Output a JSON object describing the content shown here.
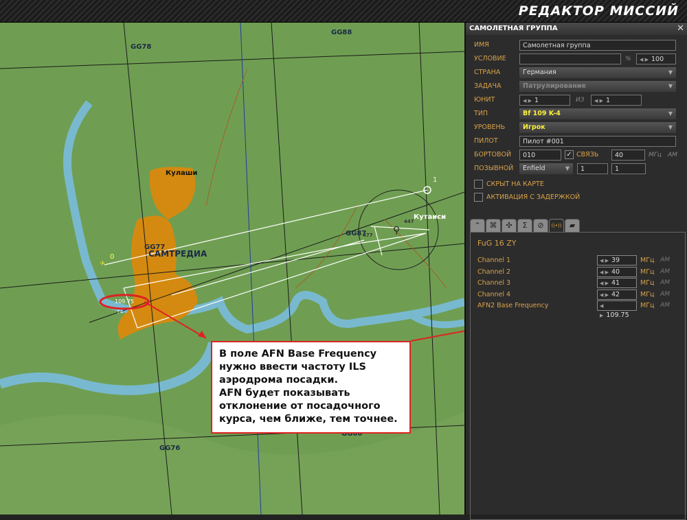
{
  "app_title": "РЕДАКТОР МИССИЙ",
  "map": {
    "grid_labels": [
      "GG88",
      "GG78",
      "GG77",
      "GG87",
      "GG76",
      "GG66"
    ],
    "cities": [
      "Кулаши",
      "САМТРЕДИА",
      "Кутаиси"
    ],
    "waypoints": [
      "0",
      "1"
    ],
    "airfield_freq": "109.75",
    "small_labels": [
      "477",
      "447",
      "74"
    ]
  },
  "panel": {
    "title": "САМОЛЕТНАЯ ГРУППА",
    "close_icon": "close-icon",
    "fields": {
      "name_label": "ИМЯ",
      "name_value": "Самолетная группа",
      "condition_label": "УСЛОВИЕ",
      "condition_value": "",
      "percent_sign": "%",
      "percent_value": "100",
      "country_label": "СТРАНА",
      "country_value": "Германия",
      "task_label": "ЗАДАЧА",
      "task_value": "Патрулирование",
      "unit_label": "ЮНИТ",
      "unit_value": "1",
      "of_label": "ИЗ",
      "unit_total": "1",
      "type_label": "ТИП",
      "type_value": "Bf 109 K-4",
      "skill_label": "УРОВЕНЬ",
      "skill_value": "Игрок",
      "pilot_label": "ПИЛОТ",
      "pilot_value": "Пилот #001",
      "board_label": "БОРТОВОЙ",
      "board_value": "010",
      "comm_label": "СВЯЗЬ",
      "comm_checked": true,
      "comm_value": "40",
      "comm_unit": "МГц",
      "comm_mod": "AM",
      "callsign_label": "ПОЗЫВНОЙ",
      "callsign_value": "Enfield",
      "callsign_n1": "1",
      "callsign_n2": "1",
      "hidden_label": "СКРЫТ НА КАРТЕ",
      "hidden_checked": false,
      "late_label": "АКТИВАЦИЯ С ЗАДЕРЖКОЙ",
      "late_checked": false
    },
    "tabs": [
      {
        "icon": "route-icon",
        "glyph": "⌃"
      },
      {
        "icon": "target-icon",
        "glyph": "⌘"
      },
      {
        "icon": "payload-icon",
        "glyph": "✣"
      },
      {
        "icon": "summary-icon",
        "glyph": "Σ"
      },
      {
        "icon": "failures-icon",
        "glyph": "⊘"
      },
      {
        "icon": "radio-icon",
        "glyph": "((•))",
        "active": true
      },
      {
        "icon": "hangar-icon",
        "glyph": "▰"
      }
    ],
    "radio": {
      "name": "FuG 16 ZY",
      "channels": [
        {
          "label": "Channel 1",
          "value": "39",
          "unit": "МГц",
          "mod": "AM"
        },
        {
          "label": "Channel 2",
          "value": "40",
          "unit": "МГц",
          "mod": "AM"
        },
        {
          "label": "Channel 3",
          "value": "41",
          "unit": "МГц",
          "mod": "AM"
        },
        {
          "label": "Channel 4",
          "value": "42",
          "unit": "МГц",
          "mod": "AM"
        },
        {
          "label": "AFN2 Base Frequency",
          "value": "109.75",
          "unit": "МГц",
          "mod": "AM"
        }
      ]
    }
  },
  "callout": {
    "lines": [
      "В поле AFN Base Frequency",
      "нужно ввести частоту ILS",
      "аэродрома посадки.",
      "AFN будет показывать",
      "отклонение от посадочного",
      "курса, чем ближе, тем точнее."
    ],
    "color": "#dd2222"
  }
}
